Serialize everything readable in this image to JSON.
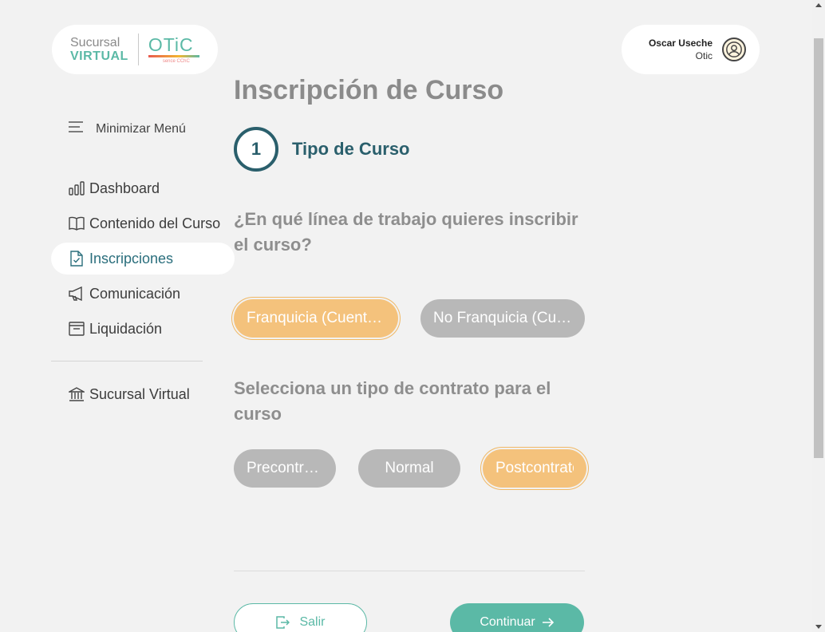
{
  "logo": {
    "sucursal": "Sucursal",
    "virtual": "VIRTUAL",
    "otic": "OTiC",
    "otic_sub": "sence CChC"
  },
  "user": {
    "name": "Oscar Useche",
    "org": "Otic",
    "icon": "user-circle-icon"
  },
  "sidebar": {
    "minimize_label": "Minimizar Menú",
    "items": [
      {
        "label": "Dashboard",
        "icon": "bar-chart-icon"
      },
      {
        "label": "Contenido del Curso",
        "icon": "book-icon"
      },
      {
        "label": "Inscripciones",
        "icon": "document-check-icon",
        "active": true
      },
      {
        "label": "Comunicación",
        "icon": "megaphone-icon"
      },
      {
        "label": "Liquidación",
        "icon": "archive-icon"
      }
    ],
    "bottom_item": {
      "label": "Sucursal Virtual",
      "icon": "bank-icon"
    }
  },
  "main": {
    "title": "Inscripción de Curso",
    "step": {
      "number": "1",
      "label": "Tipo de Curso"
    },
    "question1": "¿En qué línea de trabajo quieres inscribir el curso?",
    "line_options": [
      {
        "label": "Franquicia (Cuenta Capacitación)",
        "selected": true
      },
      {
        "label": "No Franquicia (Cuenta Excedentes)",
        "selected": false
      }
    ],
    "question2": "Selecciona un tipo de contrato para el curso",
    "contract_options": [
      {
        "label": "Precontrato",
        "selected": false
      },
      {
        "label": "Normal",
        "selected": false
      },
      {
        "label": "Postcontrato",
        "selected": true
      }
    ],
    "exit_label": "Salir",
    "continue_label": "Continuar"
  },
  "colors": {
    "accent": "#5bb9a6",
    "step": "#2a5f6c",
    "selected_option": "#f4c27c",
    "unselected_option": "#b8b8b8"
  }
}
